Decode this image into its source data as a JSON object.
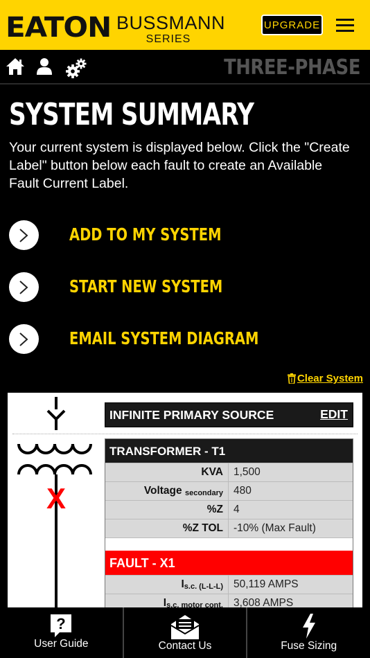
{
  "header": {
    "brand": "EATON",
    "series_line1": "BUSSMANN",
    "series_line2": "SERIES",
    "upgrade_label": "UPGRADE"
  },
  "nav": {
    "phase_title": "THREE-PHASE",
    "icons": [
      "home-icon",
      "user-icon",
      "gears-icon"
    ]
  },
  "page": {
    "title": "SYSTEM SUMMARY",
    "intro": "Your current system is displayed below. Click the \"Create Label\" button below each fault to create an Available Fault Current Label."
  },
  "actions": [
    {
      "label": "ADD TO MY SYSTEM"
    },
    {
      "label": "START NEW SYSTEM"
    },
    {
      "label": "EMAIL SYSTEM DIAGRAM"
    }
  ],
  "clear_system": "Clear System",
  "diagram": {
    "fault_marker": "X",
    "source": {
      "title": "INFINITE PRIMARY SOURCE",
      "edit_label": "EDIT"
    },
    "transformer": {
      "title": "TRANSFORMER - T1",
      "rows": [
        {
          "key": "KVA",
          "sub": "",
          "value": "1,500"
        },
        {
          "key": "Voltage",
          "sub": "secondary",
          "value": "480"
        },
        {
          "key": "%Z",
          "sub": "",
          "value": "4"
        },
        {
          "key": "%Z TOL",
          "sub": "",
          "value": "-10% (Max Fault)"
        }
      ]
    },
    "fault": {
      "title": "FAULT - X1",
      "rows": [
        {
          "key": "I",
          "sub": "s.c. (L-L-L)",
          "value": "50,119 AMPS"
        },
        {
          "key": "I",
          "sub": "s.c. motor cont.",
          "value": "3,608 AMPS"
        }
      ]
    }
  },
  "tabs": [
    {
      "label": "User Guide",
      "icon": "help-icon"
    },
    {
      "label": "Contact Us",
      "icon": "mail-icon"
    },
    {
      "label": "Fuse Sizing",
      "icon": "lightning-icon"
    }
  ],
  "colors": {
    "accent": "#ffd400",
    "fault": "#ff0000",
    "muted": "#555555"
  }
}
